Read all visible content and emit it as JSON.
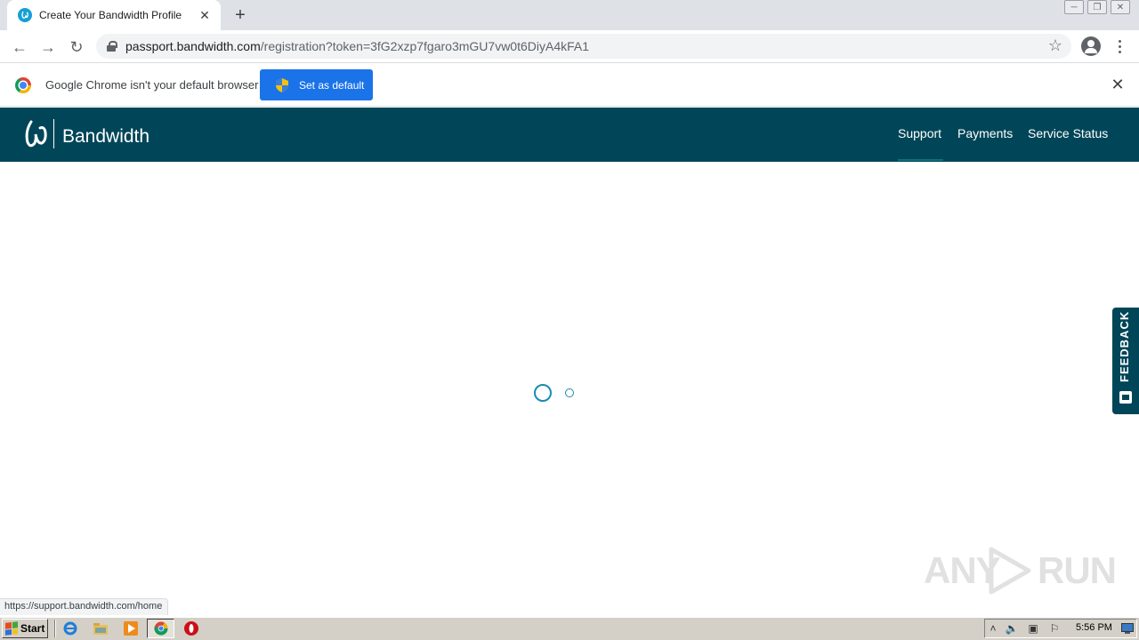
{
  "browser": {
    "tab_title": "Create Your Bandwidth Profile",
    "tab_close": "✕",
    "new_tab": "+",
    "url_host": "passport.bandwidth.com",
    "url_rest": "/registration?token=3fG2xzp7fgaro3mGU7vw0t6DiyA4kFA1",
    "nav": {
      "back": "←",
      "forward": "→",
      "reload": "↻",
      "star": "☆"
    },
    "window_controls": {
      "minimize": "─",
      "restore": "❐",
      "close": "✕"
    }
  },
  "infobar": {
    "message": "Google Chrome isn't your default browser",
    "button_label": "Set as default",
    "close": "✕"
  },
  "site_header": {
    "brand": "Bandwidth",
    "nav": [
      "Support",
      "Payments",
      "Service Status"
    ],
    "active_nav": "Support",
    "color": "#004658"
  },
  "feedback": {
    "label": "FEEDBACK"
  },
  "status_bar": {
    "hover_url": "https://support.bandwidth.com/home"
  },
  "watermark": {
    "left": "ANY",
    "right": "RUN"
  },
  "taskbar": {
    "start_label": "Start",
    "clock": "5:56 PM",
    "pinned": [
      "internet-explorer-icon",
      "folder-icon",
      "media-player-icon",
      "chrome-icon",
      "opera-icon"
    ]
  },
  "colors": {
    "accent": "#1a73e8",
    "spinner": "#1a8bb2"
  }
}
